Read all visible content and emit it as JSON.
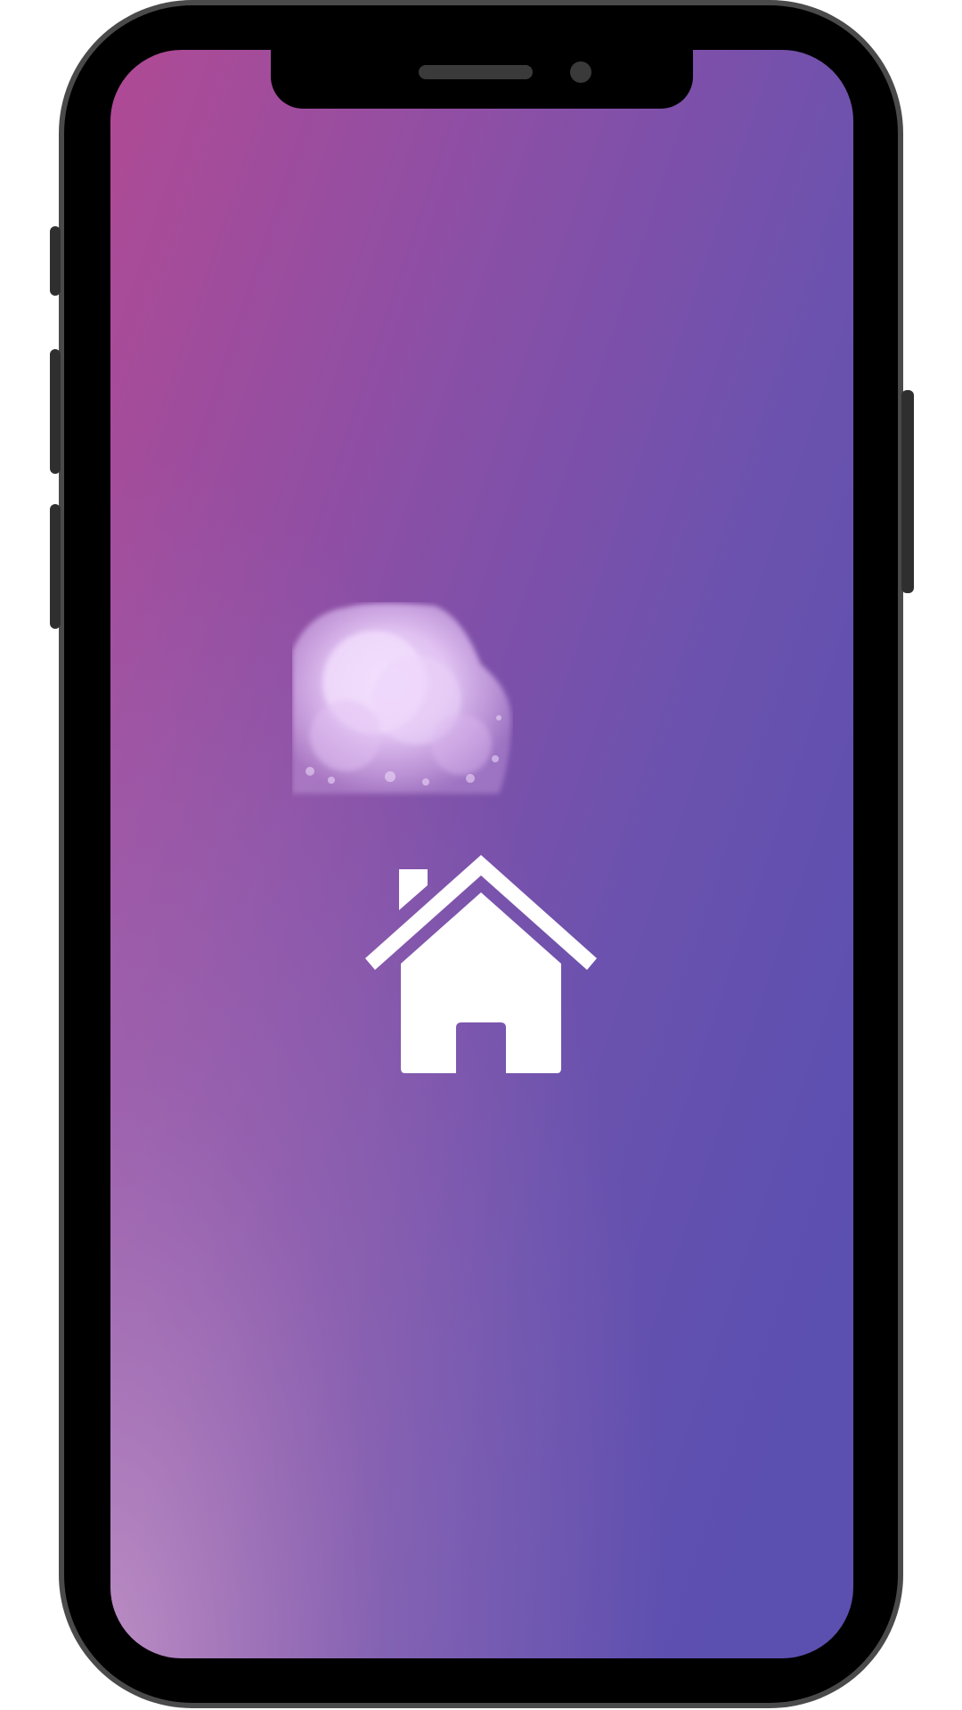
{
  "device": {
    "frame_color": "#4a4a4a",
    "bezel_color": "#000000"
  },
  "screen": {
    "gradient_colors": [
      "#b04a94",
      "#8b4fa6",
      "#6a52ae",
      "#5b4fb0",
      "#b07fbc"
    ]
  },
  "icons": {
    "cloud": "cloud-icon",
    "home": "home-icon"
  },
  "colors": {
    "icon": "#ffffff",
    "cloud": "#e8d0f8"
  }
}
